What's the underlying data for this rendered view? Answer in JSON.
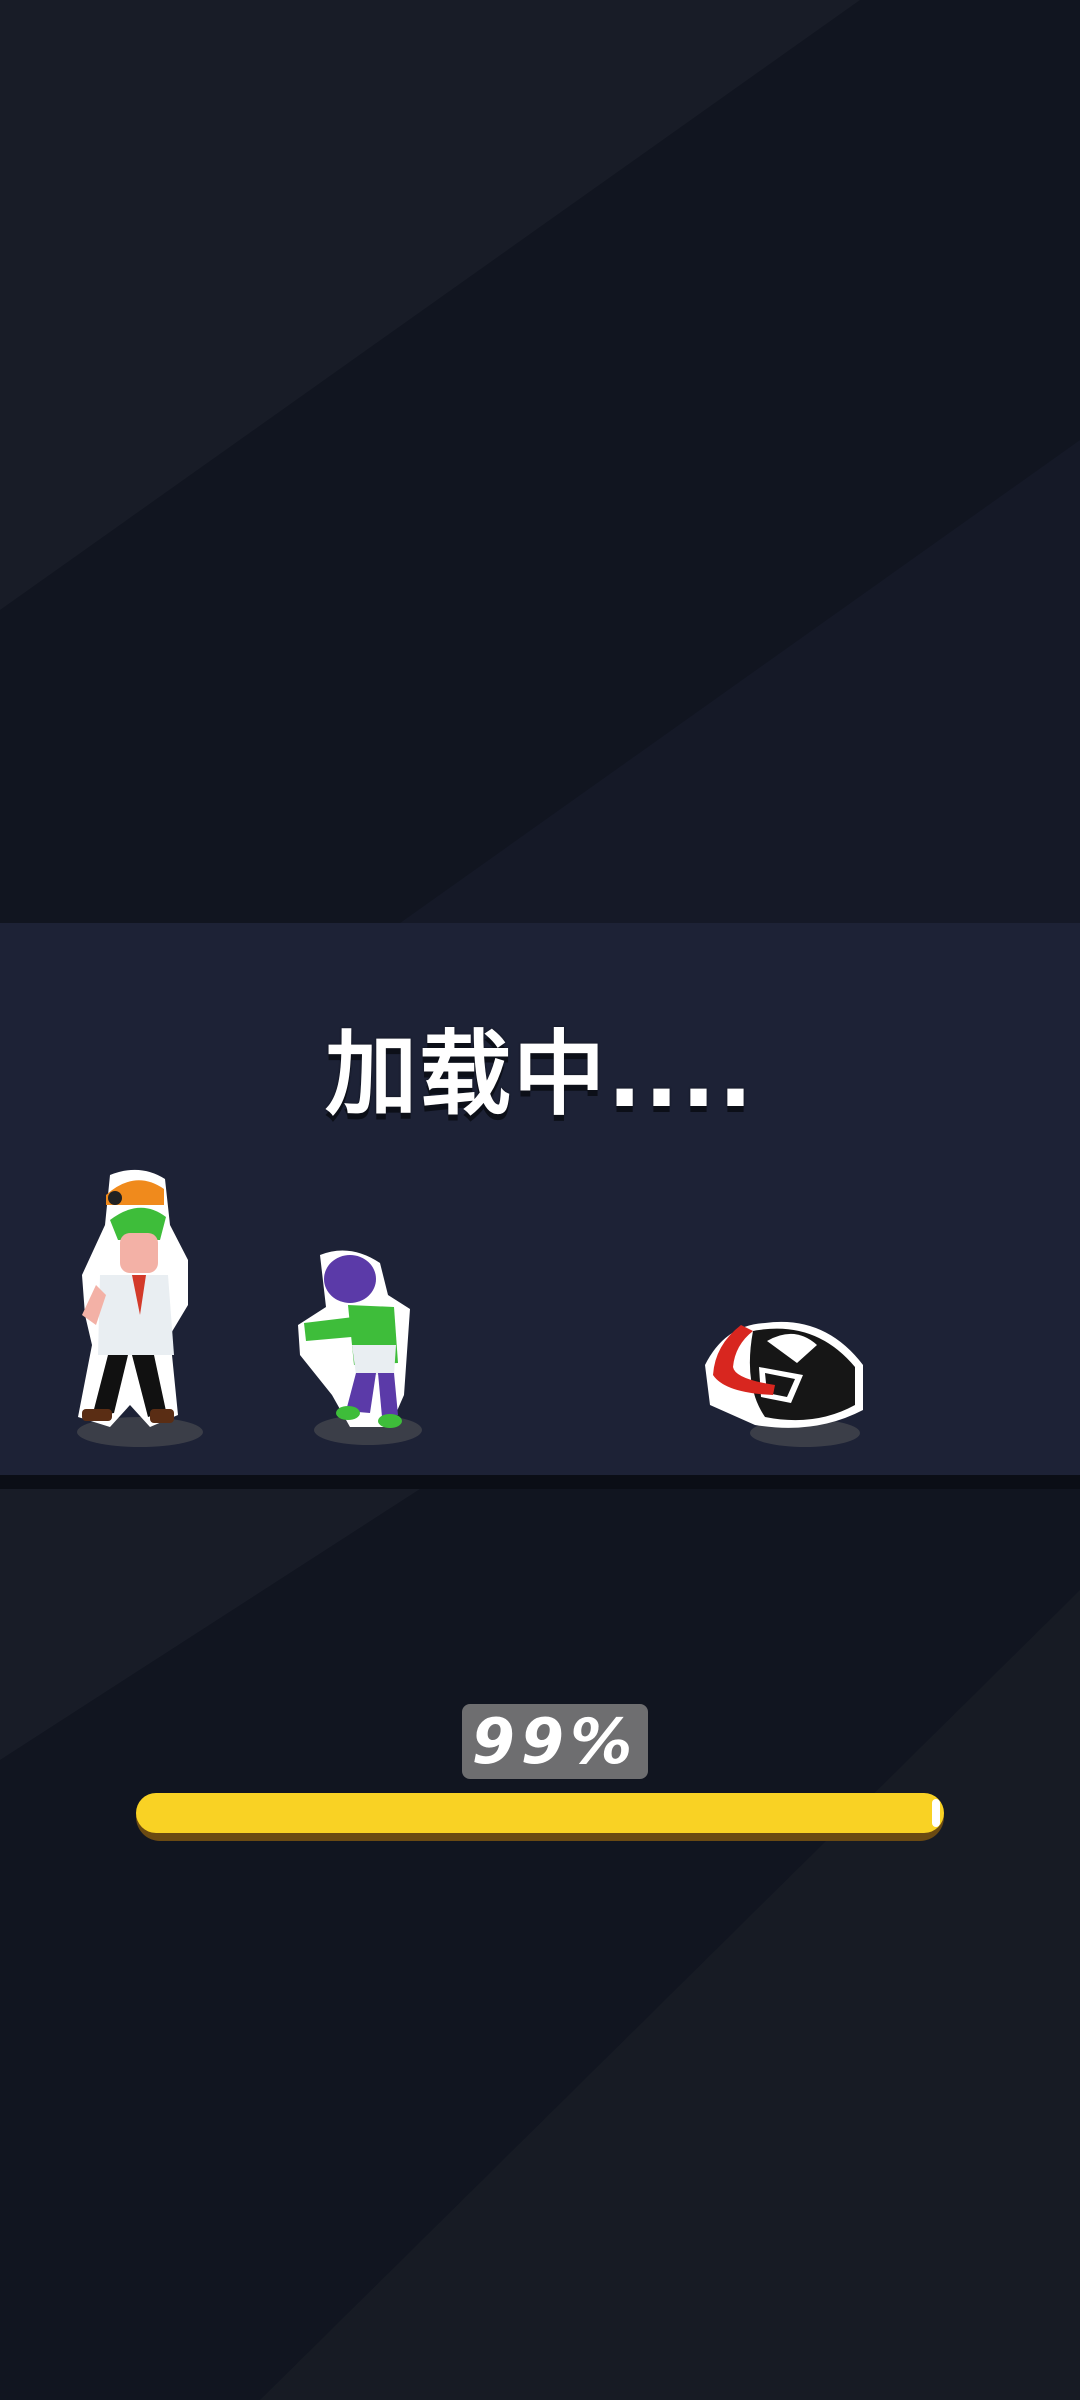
{
  "loading": {
    "title": "加载中...."
  },
  "progress": {
    "value": 0.99,
    "label": "99%"
  },
  "colors": {
    "background": "#121622",
    "banner": "#1d2236",
    "progress_fill": "#f9d224",
    "progress_track": "#6b4a12",
    "percent_box": "#6e6e70"
  },
  "characters": [
    {
      "icon": "scientist-character-icon"
    },
    {
      "icon": "zombie-character-icon"
    },
    {
      "icon": "venom-character-icon"
    }
  ]
}
